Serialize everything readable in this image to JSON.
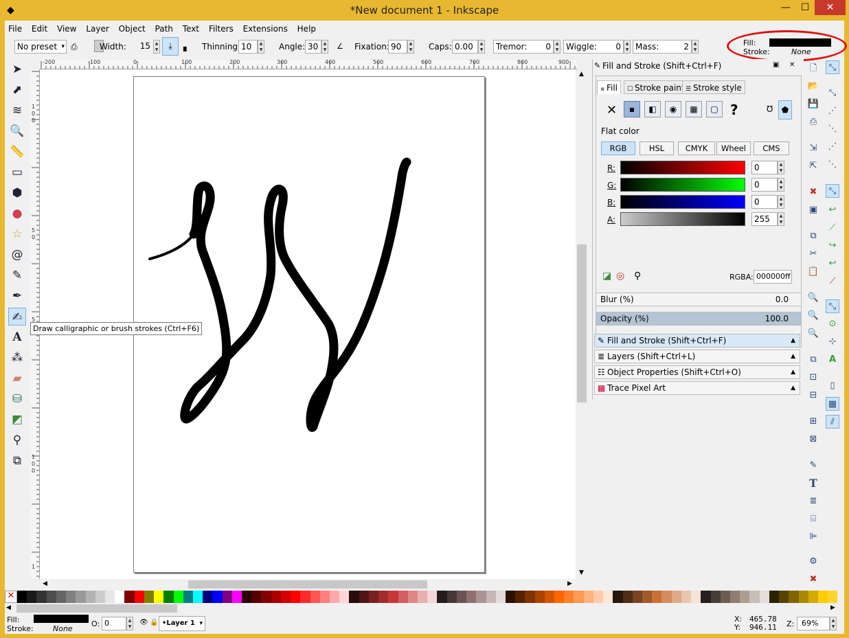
{
  "window": {
    "title": "*New document 1 - Inkscape",
    "min_icon": "minimize-icon",
    "max_icon": "maximize-icon",
    "close_icon": "close-icon"
  },
  "menu": [
    "File",
    "Edit",
    "View",
    "Layer",
    "Object",
    "Path",
    "Text",
    "Filters",
    "Extensions",
    "Help"
  ],
  "toolctrl": {
    "preset": "No preset",
    "width_label": "Width:",
    "width_value": "15",
    "thinning_label": "Thinning:",
    "thinning_value": "10",
    "angle_label": "Angle:",
    "angle_value": "30",
    "fixation_label": "Fixation:",
    "fixation_value": "90",
    "caps_label": "Caps:",
    "caps_value": "0.00",
    "tremor_label": "Tremor:",
    "tremor_value": "0",
    "wiggle_label": "Wiggle:",
    "wiggle_value": "0",
    "mass_label": "Mass:",
    "mass_value": "2"
  },
  "style_indicator": {
    "fill_label": "Fill:",
    "stroke_label": "Stroke:",
    "stroke_value": "None",
    "fill_color": "#000000"
  },
  "tooltip": "Draw calligraphic or brush strokes (Ctrl+F6)",
  "ruler_ticks": [
    "-200",
    "-100",
    "0",
    "100",
    "200",
    "300",
    "400",
    "500",
    "600",
    "700",
    "800",
    "900"
  ],
  "vruler_ticks": [
    "1",
    "0",
    "0",
    "5",
    "0",
    "5",
    "1",
    "0",
    "0",
    "1"
  ],
  "dialog": {
    "title": "Fill and Stroke (Shift+Ctrl+F)",
    "tabs": [
      "Fill",
      "Stroke paint",
      "Stroke style"
    ],
    "flat_color_label": "Flat color",
    "modes": [
      "RGB",
      "HSL",
      "CMYK",
      "Wheel",
      "CMS"
    ],
    "channels": [
      {
        "label": "R:",
        "value": "0"
      },
      {
        "label": "G:",
        "value": "0"
      },
      {
        "label": "B:",
        "value": "0"
      },
      {
        "label": "A:",
        "value": "255"
      }
    ],
    "rgba_label": "RGBA:",
    "rgba_value": "000000ff",
    "blur_label": "Blur (%)",
    "blur_value": "0.0",
    "opacity_label": "Opacity (%)",
    "opacity_value": "100.0"
  },
  "docks": [
    "Fill and Stroke (Shift+Ctrl+F)",
    "Layers (Shift+Ctrl+L)",
    "Object Properties (Shift+Ctrl+O)",
    "Trace Pixel Art"
  ],
  "status": {
    "fill_label": "Fill:",
    "stroke_label": "Stroke:",
    "stroke_value": "None",
    "opacity_label": "O:",
    "opacity_value": "0",
    "layer": "•Layer 1",
    "x_label": "X:",
    "x_value": "465.78",
    "y_label": "Y:",
    "y_value": "946.11",
    "zoom_label": "Z:",
    "zoom_value": "69%"
  },
  "palette_colors": [
    "#000000",
    "#1a1a1a",
    "#333333",
    "#4d4d4d",
    "#666666",
    "#808080",
    "#999999",
    "#b3b3b3",
    "#cccccc",
    "#e6e6e6",
    "#ffffff",
    "#800000",
    "#ff0000",
    "#808000",
    "#ffff00",
    "#008000",
    "#00ff00",
    "#008080",
    "#00ffff",
    "#000080",
    "#0000ff",
    "#800080",
    "#ff00ff",
    "#2b0000",
    "#550000",
    "#800000",
    "#aa0000",
    "#d40000",
    "#ff0000",
    "#ff2a2a",
    "#ff5555",
    "#ff8080",
    "#ffaaaa",
    "#ffd5d5",
    "#280b0b",
    "#501616",
    "#782121",
    "#a02c2c",
    "#c83737",
    "#d35f5f",
    "#de8787",
    "#e9afaf",
    "#f4d7d7",
    "#241c1c",
    "#483737",
    "#6c5353",
    "#916f6f",
    "#ac9393",
    "#c8b7b7",
    "#e3dbdb",
    "#2b1100",
    "#552200",
    "#803300",
    "#aa4400",
    "#d45500",
    "#ff6600",
    "#ff7f2a",
    "#ff9955",
    "#ffb380",
    "#ffccaa",
    "#ffe6d5",
    "#28170b",
    "#502d16",
    "#784421",
    "#a05a2c",
    "#c87137",
    "#d38d5f",
    "#deaa87",
    "#e9c6af",
    "#f4e3d7",
    "#241f1c",
    "#483e37",
    "#6c5d53",
    "#917c6f",
    "#ac9d93",
    "#c8beb7",
    "#e3dedb",
    "#2b2200",
    "#554400",
    "#806600",
    "#aa8800",
    "#d4aa00",
    "#ffcc00",
    "#ffd42a"
  ]
}
